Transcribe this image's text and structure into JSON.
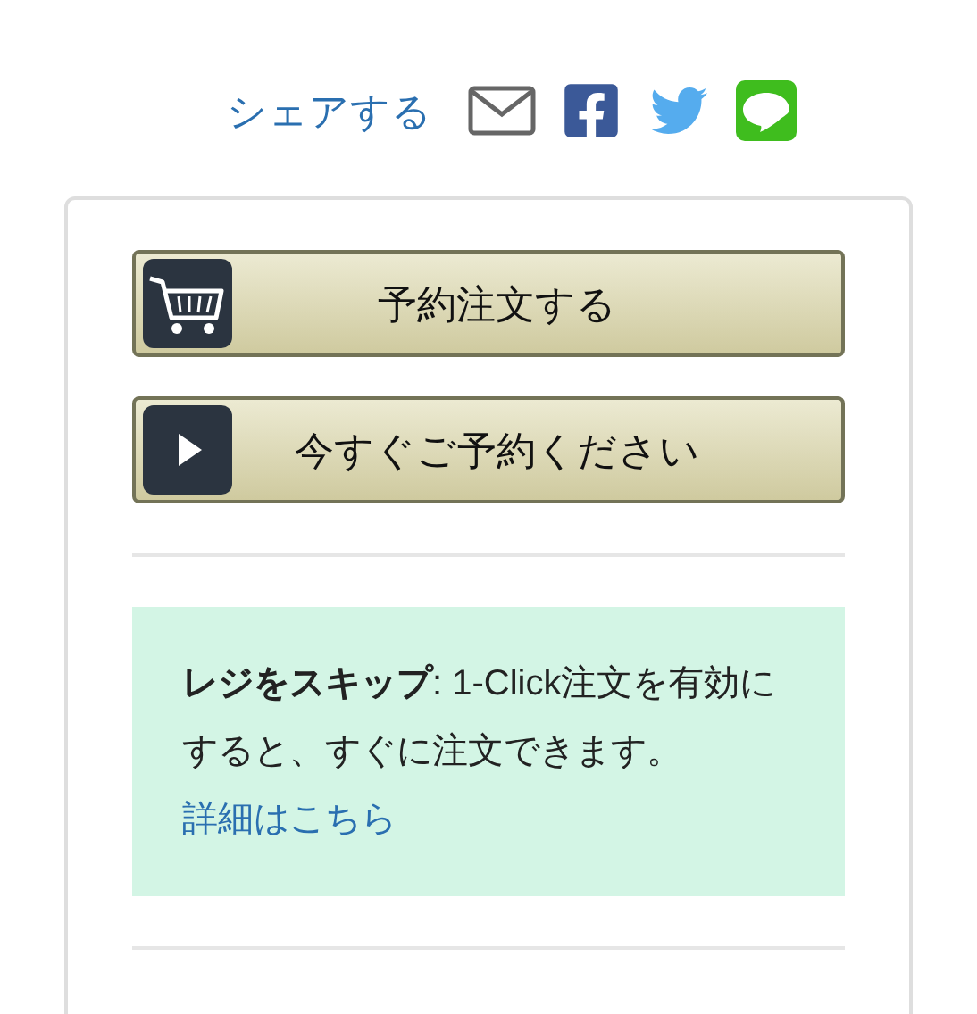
{
  "share": {
    "label": "シェアする"
  },
  "buttons": [
    {
      "label": "予約注文する",
      "kind": "cart"
    },
    {
      "label": "今すぐご予約ください",
      "kind": "play"
    }
  ],
  "skip_notice": {
    "text": "**レジをスキップ**: 1-Click注文を有効にすると、すぐに注文できます。",
    "link": "詳細はこちら"
  }
}
